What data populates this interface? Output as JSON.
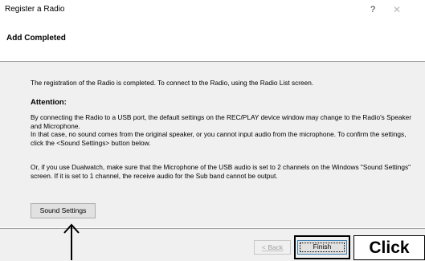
{
  "window": {
    "title": "Register a Radio",
    "help_glyph": "?",
    "close_glyph": "✕"
  },
  "header": {
    "title": "Add Completed"
  },
  "content": {
    "intro": "The registration of the Radio is completed. To connect to the Radio, using the Radio List screen.",
    "attention_label": "Attention:",
    "attention_text_1": "By connecting the Radio to a USB port, the default settings on the REC/PLAY device window may change to the Radio's Speaker and Microphone.",
    "attention_text_2": "In that case, no sound comes from the original speaker, or you cannot input audio from the microphone. To confirm the settings, click the <Sound Settings> button below.",
    "dualwatch_text": "Or, if you use Dualwatch, make sure that the Microphone of the USB audio is set to 2 channels on the Windows \"Sound Settings\" screen. If it is set to 1 channel, the receive audio for the Sub band cannot be output.",
    "sound_settings_label": "Sound Settings"
  },
  "footer": {
    "back_label": "< Back",
    "finish_label": "Finish"
  },
  "annotation": {
    "click_label": "Click",
    "arrow_icon": "up-arrow-icon"
  }
}
